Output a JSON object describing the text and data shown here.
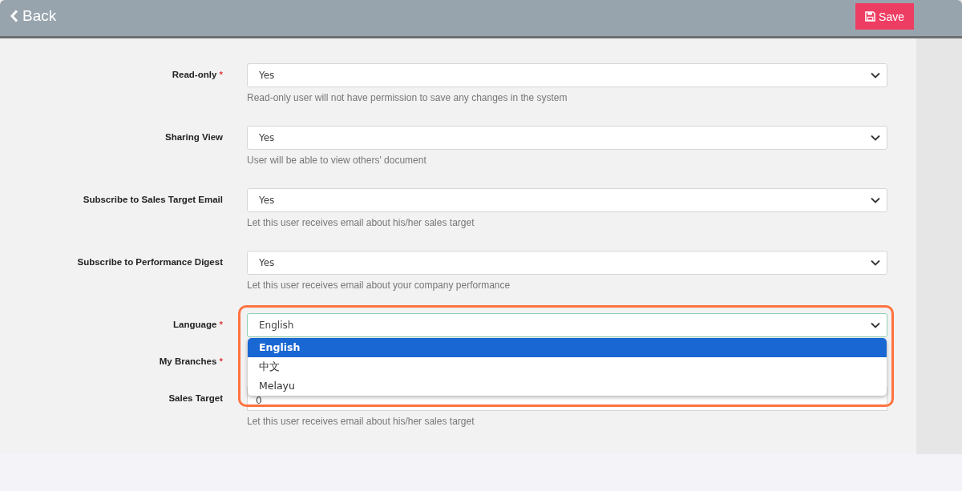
{
  "top_bar": {
    "back_label": "Back",
    "save_label": "Save"
  },
  "fields": [
    {
      "label": "Read-only",
      "required_mark": "*",
      "kind": "select",
      "value": "Yes",
      "help": "Read-only user will not have permission to save any changes in the system"
    },
    {
      "label": "Sharing View",
      "kind": "select",
      "value": "Yes",
      "help": "User will be able to view others' document"
    },
    {
      "label": "Subscribe to Sales Target Email",
      "kind": "select",
      "value": "Yes",
      "help": "Let this user receives email about his/her sales target"
    },
    {
      "label": "Subscribe to Performance Digest",
      "kind": "select",
      "value": "Yes",
      "help": "Let this user receives email about your company performance"
    },
    {
      "label": "Language",
      "required_mark": "*",
      "kind": "select",
      "value": "English",
      "focused": true,
      "dropdown": [
        {
          "label": "English",
          "selected": true
        },
        {
          "label": "中文",
          "selected": false
        },
        {
          "label": "Melayu",
          "selected": false
        }
      ]
    },
    {
      "label": "My Branches",
      "required_mark": "*",
      "kind": "covered"
    },
    {
      "label": "Sales Target",
      "kind": "input",
      "value": "0",
      "help": "Let this user receives email about his/her sales target"
    }
  ]
}
